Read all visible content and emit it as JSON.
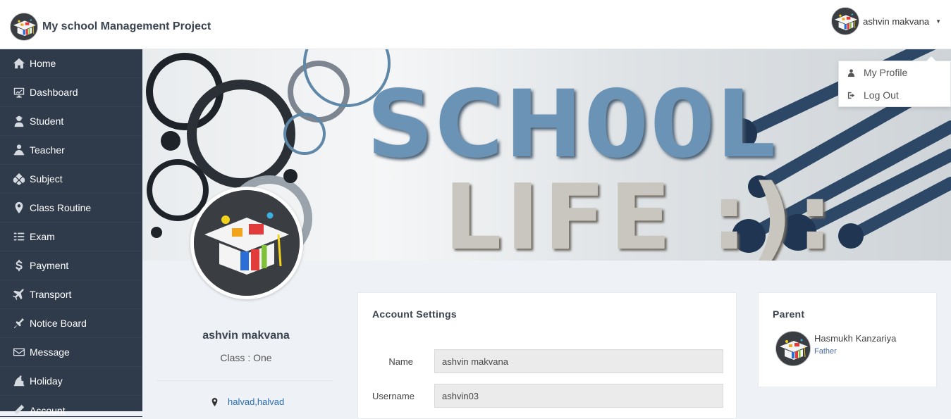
{
  "app": {
    "title": "My school Management Project"
  },
  "user": {
    "name": "ashvin makvana"
  },
  "dropdown": {
    "items": [
      {
        "label": "My Profile",
        "icon": "user-icon"
      },
      {
        "label": "Log Out",
        "icon": "logout-icon"
      }
    ]
  },
  "sidebar": {
    "items": [
      {
        "label": "Home",
        "icon": "home-icon"
      },
      {
        "label": "Dashboard",
        "icon": "dashboard-icon"
      },
      {
        "label": "Student",
        "icon": "student-icon"
      },
      {
        "label": "Teacher",
        "icon": "teacher-icon"
      },
      {
        "label": "Subject",
        "icon": "subject-icon"
      },
      {
        "label": "Class Routine",
        "icon": "map-marker-icon"
      },
      {
        "label": "Exam",
        "icon": "exam-icon"
      },
      {
        "label": "Payment",
        "icon": "dollar-icon"
      },
      {
        "label": "Transport",
        "icon": "plane-icon"
      },
      {
        "label": "Notice Board",
        "icon": "notice-icon"
      },
      {
        "label": "Message",
        "icon": "envelope-icon"
      },
      {
        "label": "Holiday",
        "icon": "holiday-icon"
      },
      {
        "label": "Account",
        "icon": "account-icon"
      }
    ]
  },
  "banner": {
    "line1": "SCH00L",
    "line2": "LIFE :):"
  },
  "profile": {
    "name": "ashvin makvana",
    "class_text": "Class : One",
    "address": "halvad,halvad"
  },
  "account_settings": {
    "title": "Account Settings",
    "fields": [
      {
        "label": "Name",
        "value": "ashvin makvana"
      },
      {
        "label": "Username",
        "value": "ashvin03"
      }
    ]
  },
  "parent": {
    "title": "Parent",
    "name": "Hasmukh Kanzariya",
    "relation": "Father"
  },
  "colors": {
    "sidebar_bg": "#2f3a4a",
    "banner_text_blue": "#6b93b5",
    "link_blue": "#2a6fb5"
  }
}
